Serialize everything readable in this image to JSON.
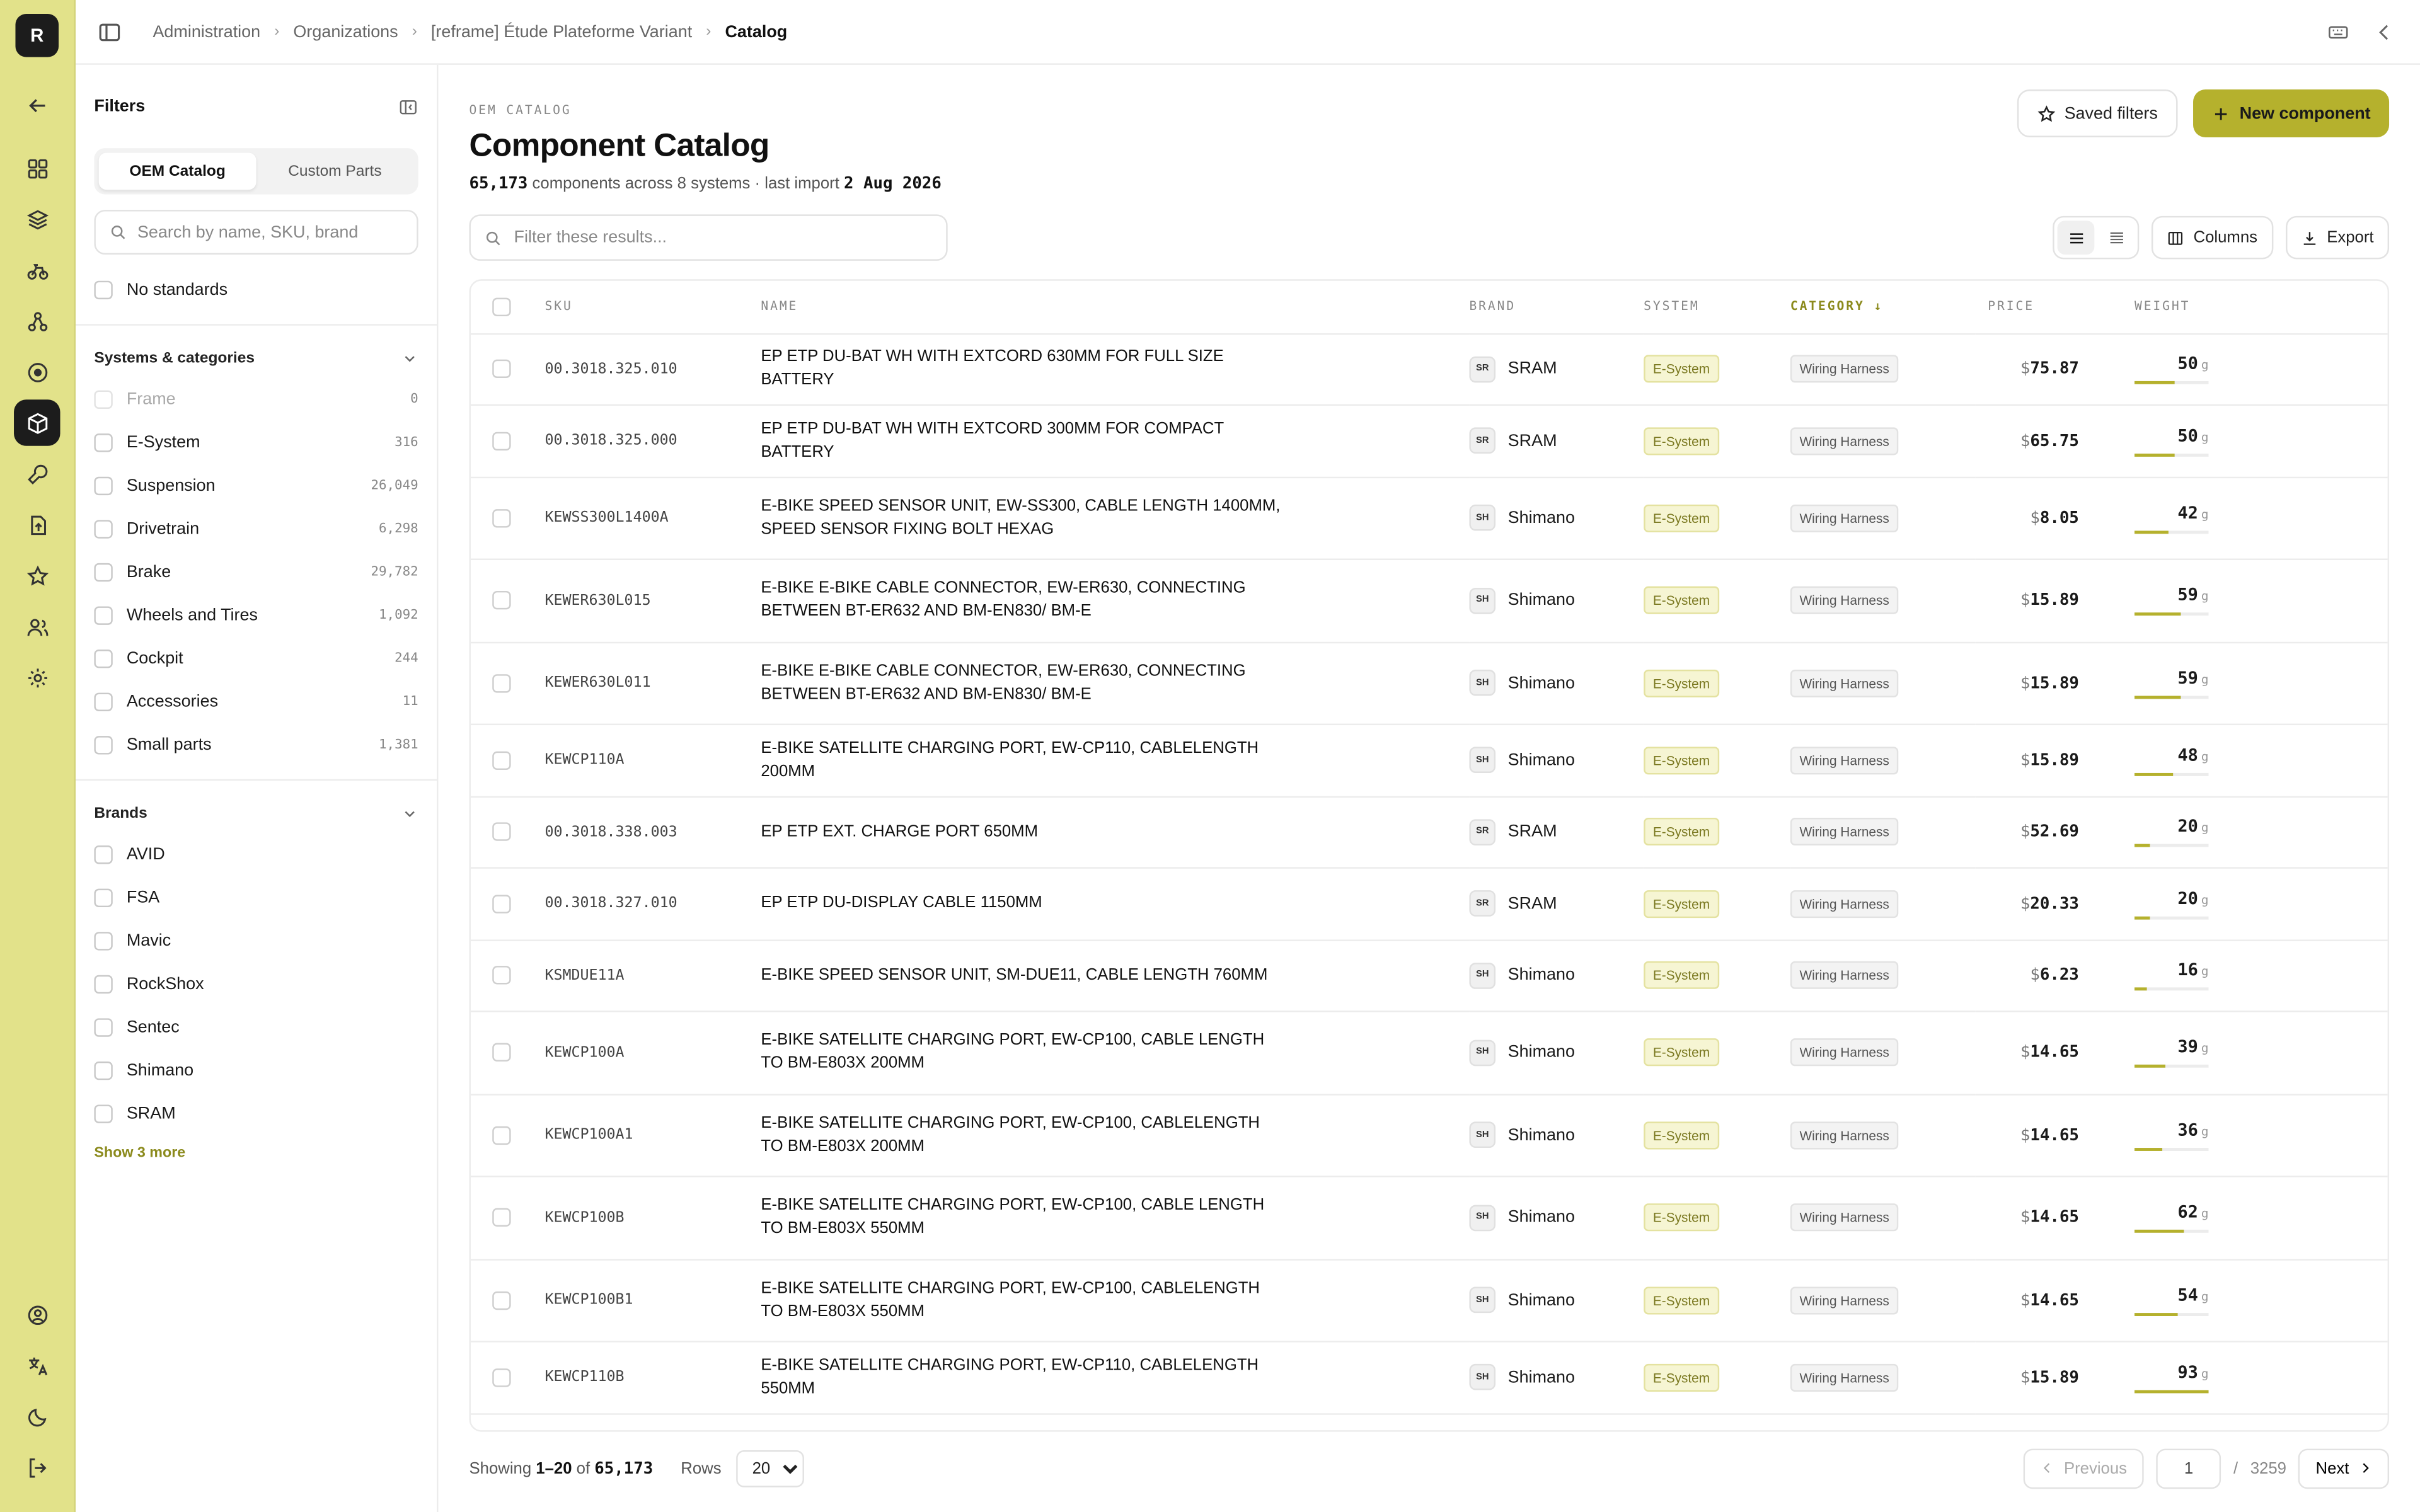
{
  "rail": {
    "logo": "R",
    "items": [
      {
        "icon": "arrow-left-icon",
        "name": "rail-back"
      },
      {
        "icon": "grid-icon",
        "name": "rail-dashboard"
      },
      {
        "icon": "layers-icon",
        "name": "rail-layers"
      },
      {
        "icon": "bike-icon",
        "name": "rail-bikes"
      },
      {
        "icon": "nodes-icon",
        "name": "rail-hierarchy"
      },
      {
        "icon": "target-icon",
        "name": "rail-target"
      },
      {
        "icon": "box-icon",
        "name": "rail-catalog",
        "active": true
      },
      {
        "icon": "wrench-icon",
        "name": "rail-tools"
      },
      {
        "icon": "upload-icon",
        "name": "rail-import"
      },
      {
        "icon": "star-icon",
        "name": "rail-favorites"
      },
      {
        "icon": "users-icon",
        "name": "rail-users"
      },
      {
        "icon": "gear-icon",
        "name": "rail-settings"
      }
    ],
    "bottom": [
      {
        "icon": "user-circle-icon",
        "name": "rail-profile"
      },
      {
        "icon": "translate-icon",
        "name": "rail-language"
      },
      {
        "icon": "moon-icon",
        "name": "rail-theme"
      },
      {
        "icon": "logout-icon",
        "name": "rail-logout"
      }
    ]
  },
  "breadcrumb": [
    "Administration",
    "Organizations",
    "[reframe] Étude Plateforme Variant",
    "Catalog"
  ],
  "filters": {
    "title": "Filters",
    "tabs": [
      "OEM Catalog",
      "Custom Parts"
    ],
    "search_placeholder": "Search by name, SKU, brand",
    "no_standards": "No standards",
    "systems_title": "Systems & categories",
    "systems": [
      {
        "label": "Frame",
        "count": "0",
        "disabled": true
      },
      {
        "label": "E-System",
        "count": "316"
      },
      {
        "label": "Suspension",
        "count": "26,049"
      },
      {
        "label": "Drivetrain",
        "count": "6,298"
      },
      {
        "label": "Brake",
        "count": "29,782"
      },
      {
        "label": "Wheels and Tires",
        "count": "1,092"
      },
      {
        "label": "Cockpit",
        "count": "244"
      },
      {
        "label": "Accessories",
        "count": "11"
      },
      {
        "label": "Small parts",
        "count": "1,381"
      }
    ],
    "brands_title": "Brands",
    "brands": [
      "AVID",
      "FSA",
      "Mavic",
      "RockShox",
      "Sentec",
      "Shimano",
      "SRAM"
    ],
    "show_more": "Show 3 more"
  },
  "main": {
    "eyebrow": "OEM CATALOG",
    "title": "Component Catalog",
    "count": "65,173",
    "subtitle_mid": "components across 8 systems · last import",
    "last_import": "2 Aug 2026",
    "saved_filters": "Saved filters",
    "new_component": "New component",
    "filter_placeholder": "Filter these results...",
    "columns_label": "Columns",
    "export_label": "Export"
  },
  "table": {
    "headers": {
      "sku": "SKU",
      "name": "NAME",
      "brand": "BRAND",
      "system": "SYSTEM",
      "category": "CATEGORY",
      "price": "PRICE",
      "weight": "WEIGHT"
    },
    "currency": "$",
    "weight_unit": "g",
    "rows": [
      {
        "sku": "00.3018.325.010",
        "name": "EP ETP DU-BAT WH WITH EXTCORD 630MM FOR FULL SIZE BATTERY",
        "brand": "SRAM",
        "badge": "SR",
        "system": "E-System",
        "category": "Wiring Harness",
        "price": "75.87",
        "weight": "50",
        "fill": 0.54
      },
      {
        "sku": "00.3018.325.000",
        "name": "EP ETP DU-BAT WH WITH EXTCORD 300MM FOR COMPACT BATTERY",
        "brand": "SRAM",
        "badge": "SR",
        "system": "E-System",
        "category": "Wiring Harness",
        "price": "65.75",
        "weight": "50",
        "fill": 0.54
      },
      {
        "sku": "KEWSS300L1400A",
        "name": "E-BIKE SPEED SENSOR UNIT, EW-SS300, CABLE LENGTH 1400MM, SPEED SENSOR FIXING BOLT HEXAG",
        "brand": "Shimano",
        "badge": "SH",
        "system": "E-System",
        "category": "Wiring Harness",
        "price": "8.05",
        "weight": "42",
        "fill": 0.45
      },
      {
        "sku": "KEWER630L015",
        "name": "E-BIKE E-BIKE CABLE CONNECTOR, EW-ER630, CONNECTING BETWEEN BT-ER632 AND BM-EN830/ BM-E",
        "brand": "Shimano",
        "badge": "SH",
        "system": "E-System",
        "category": "Wiring Harness",
        "price": "15.89",
        "weight": "59",
        "fill": 0.63
      },
      {
        "sku": "KEWER630L011",
        "name": "E-BIKE E-BIKE CABLE CONNECTOR, EW-ER630, CONNECTING BETWEEN BT-ER632 AND BM-EN830/ BM-E",
        "brand": "Shimano",
        "badge": "SH",
        "system": "E-System",
        "category": "Wiring Harness",
        "price": "15.89",
        "weight": "59",
        "fill": 0.63
      },
      {
        "sku": "KEWCP110A",
        "name": "E-BIKE SATELLITE CHARGING PORT, EW-CP110, CABLELENGTH 200MM",
        "brand": "Shimano",
        "badge": "SH",
        "system": "E-System",
        "category": "Wiring Harness",
        "price": "15.89",
        "weight": "48",
        "fill": 0.52
      },
      {
        "sku": "00.3018.338.003",
        "name": "EP ETP EXT. CHARGE PORT 650MM",
        "brand": "SRAM",
        "badge": "SR",
        "system": "E-System",
        "category": "Wiring Harness",
        "price": "52.69",
        "weight": "20",
        "fill": 0.2
      },
      {
        "sku": "00.3018.327.010",
        "name": "EP ETP DU-DISPLAY CABLE 1150MM",
        "brand": "SRAM",
        "badge": "SR",
        "system": "E-System",
        "category": "Wiring Harness",
        "price": "20.33",
        "weight": "20",
        "fill": 0.2
      },
      {
        "sku": "KSMDUE11A",
        "name": "E-BIKE SPEED SENSOR UNIT, SM-DUE11, CABLE LENGTH 760MM",
        "brand": "Shimano",
        "badge": "SH",
        "system": "E-System",
        "category": "Wiring Harness",
        "price": "6.23",
        "weight": "16",
        "fill": 0.16
      },
      {
        "sku": "KEWCP100A",
        "name": "E-BIKE SATELLITE CHARGING PORT, EW-CP100, CABLE LENGTH TO BM-E803X 200MM",
        "brand": "Shimano",
        "badge": "SH",
        "system": "E-System",
        "category": "Wiring Harness",
        "price": "14.65",
        "weight": "39",
        "fill": 0.42
      },
      {
        "sku": "KEWCP100A1",
        "name": "E-BIKE SATELLITE CHARGING PORT, EW-CP100, CABLELENGTH TO BM-E803X 200MM",
        "brand": "Shimano",
        "badge": "SH",
        "system": "E-System",
        "category": "Wiring Harness",
        "price": "14.65",
        "weight": "36",
        "fill": 0.38
      },
      {
        "sku": "KEWCP100B",
        "name": "E-BIKE SATELLITE CHARGING PORT, EW-CP100, CABLE LENGTH TO BM-E803X 550MM",
        "brand": "Shimano",
        "badge": "SH",
        "system": "E-System",
        "category": "Wiring Harness",
        "price": "14.65",
        "weight": "62",
        "fill": 0.66
      },
      {
        "sku": "KEWCP100B1",
        "name": "E-BIKE SATELLITE CHARGING PORT, EW-CP100, CABLELENGTH TO BM-E803X 550MM",
        "brand": "Shimano",
        "badge": "SH",
        "system": "E-System",
        "category": "Wiring Harness",
        "price": "14.65",
        "weight": "54",
        "fill": 0.58
      },
      {
        "sku": "KEWCP110B",
        "name": "E-BIKE SATELLITE CHARGING PORT, EW-CP110, CABLELENGTH 550MM",
        "brand": "Shimano",
        "badge": "SH",
        "system": "E-System",
        "category": "Wiring Harness",
        "price": "15.89",
        "weight": "93",
        "fill": 1.0
      }
    ]
  },
  "footer": {
    "showing": "Showing",
    "range": "1–20",
    "of": "of",
    "total": "65,173",
    "rows_label": "Rows",
    "rows_value": "20",
    "previous": "Previous",
    "page": "1",
    "page_sep": "/",
    "pages": "3259",
    "next": "Next"
  }
}
